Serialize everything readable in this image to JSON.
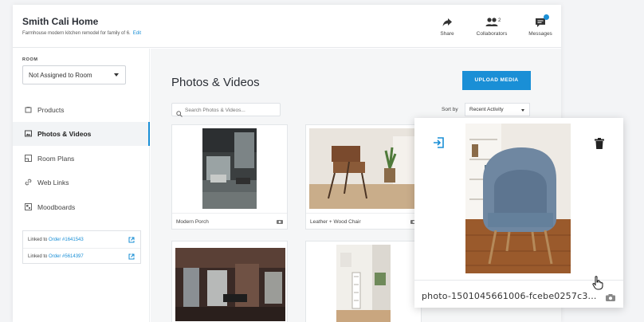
{
  "header": {
    "title": "Smith Cali Home",
    "subtitle": "Farmhouse modern kitchen remodel for family of 6.",
    "edit_label": "Edit",
    "share_label": "Share",
    "collaborators_label": "Collaborators",
    "collaborators_count": "2",
    "messages_label": "Messages"
  },
  "sidebar": {
    "room_label": "ROOM",
    "room_value": "Not Assigned to Room",
    "items": [
      {
        "label": "Products",
        "icon": "products-icon"
      },
      {
        "label": "Photos & Videos",
        "icon": "photo-icon",
        "active": true
      },
      {
        "label": "Room Plans",
        "icon": "plan-icon"
      },
      {
        "label": "Web Links",
        "icon": "link-icon"
      },
      {
        "label": "Moodboards",
        "icon": "moodboard-icon"
      }
    ],
    "orders": [
      {
        "prefix": "Linked to",
        "link": "Order #1641543"
      },
      {
        "prefix": "Linked to",
        "link": "Order #5614397"
      }
    ]
  },
  "main": {
    "title": "Photos & Videos",
    "upload_label": "UPLOAD MEDIA",
    "search_placeholder": "Search Photos & Videos...",
    "sort_label": "Sort by",
    "sort_value": "Recent Activity",
    "cards": [
      {
        "caption": "Modern Porch"
      },
      {
        "caption": "Leather + Wood Chair"
      },
      {
        "caption": ""
      },
      {
        "caption": ""
      }
    ]
  },
  "popup": {
    "filename": "photo-1501045661006-fcebe0257c3..."
  },
  "colors": {
    "accent": "#1a8fd6",
    "text": "#2b2f36"
  }
}
